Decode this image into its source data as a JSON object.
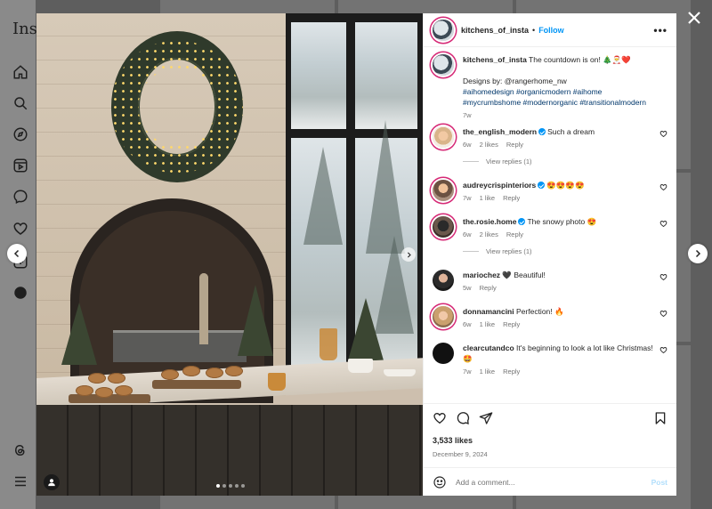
{
  "background": {
    "app_logo_partial": "Inst"
  },
  "post": {
    "username": "kitchens_of_insta",
    "separator": "•",
    "follow_label": "Follow",
    "more_label": "•••",
    "carousel": {
      "count": 5,
      "active_index": 0
    }
  },
  "caption": {
    "username": "kitchens_of_insta",
    "line1": "The countdown is on! 🎄🎅❤️",
    "line2": "Designs by: @rangerhome_nw",
    "hashtags": "#aihomedesign #organicmodern #aihome #mycrumbshome #modernorganic #transitionalmodern",
    "time": "7w"
  },
  "comments": [
    {
      "username": "the_english_modern",
      "verified": true,
      "text": "Such a dream",
      "time": "6w",
      "likes": "2 likes",
      "reply": "Reply",
      "view_replies": "View replies (1)"
    },
    {
      "username": "audreycrispinteriors",
      "verified": true,
      "text": "😍😍😍😍",
      "time": "7w",
      "likes": "1 like",
      "reply": "Reply"
    },
    {
      "username": "the.rosie.home",
      "verified": true,
      "text": "The snowy photo 😍",
      "time": "6w",
      "likes": "2 likes",
      "reply": "Reply",
      "view_replies": "View replies (1)"
    },
    {
      "username": "mariochez",
      "verified": false,
      "text": "🖤 Beautiful!",
      "time": "5w",
      "reply": "Reply"
    },
    {
      "username": "donnamancini",
      "verified": false,
      "text": "Perfection! 🔥",
      "time": "6w",
      "likes": "1 like",
      "reply": "Reply"
    },
    {
      "username": "clearcutandco",
      "verified": false,
      "text": "It's beginning to look a lot like Christmas! 🤩",
      "time": "7w",
      "likes": "1 like",
      "reply": "Reply"
    }
  ],
  "stats": {
    "likes": "3,533 likes",
    "date": "December 9, 2024"
  },
  "composer": {
    "placeholder": "Add a comment...",
    "post_label": "Post"
  },
  "icons": {
    "close": "close-icon",
    "prev": "chevron-left-icon",
    "next": "chevron-right-icon",
    "like": "heart-icon",
    "comment": "comment-icon",
    "share": "send-icon",
    "save": "bookmark-icon",
    "emoji": "smiley-icon",
    "tag": "user-tag-icon"
  },
  "colors": {
    "accent": "#0095f6",
    "hashtag": "#00376b",
    "muted": "#737373",
    "post_disabled": "#b2dffc"
  }
}
